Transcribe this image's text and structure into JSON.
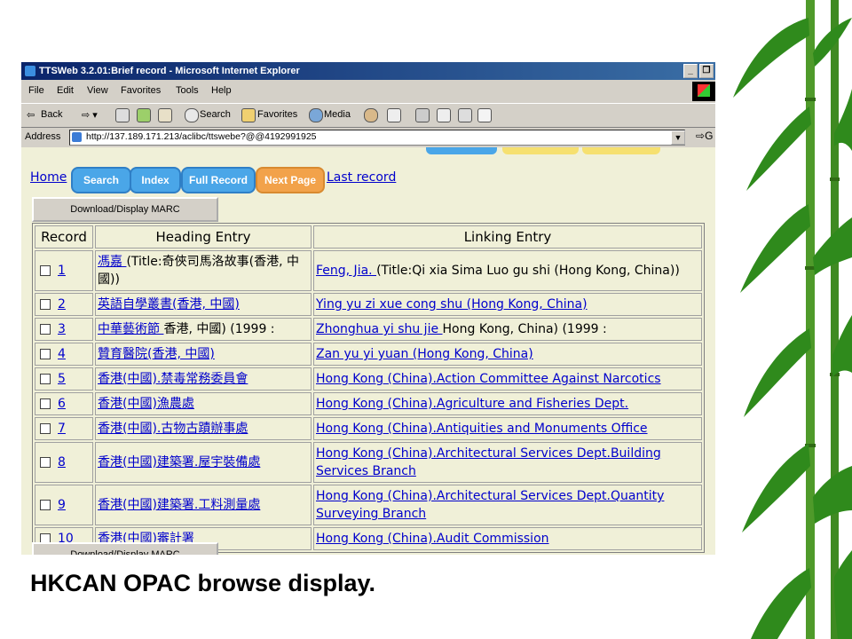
{
  "window": {
    "title": "TTSWeb 3.2.01:Brief record - Microsoft Internet Explorer",
    "minimize_glyph": "_",
    "restore_glyph": "❐"
  },
  "menu": [
    "File",
    "Edit",
    "View",
    "Favorites",
    "Tools",
    "Help"
  ],
  "toolbar": {
    "back": "Back",
    "search": "Search",
    "favorites": "Favorites",
    "media": "Media"
  },
  "address": {
    "label": "Address",
    "url": "http://137.189.171.213/aclibc/ttswebe?@@4192991925",
    "go": "G"
  },
  "page": {
    "links": {
      "home": "Home",
      "last_record": "Last record"
    },
    "buttons": {
      "search": "Search",
      "index": "Index",
      "full_record": "Full Record",
      "next_page": "Next Page"
    },
    "download_button": "Download/Display MARC",
    "table": {
      "headers": [
        "Record",
        "Heading Entry",
        "Linking Entry"
      ],
      "rows": [
        {
          "num": "1",
          "heading_link": "馮嘉 ",
          "heading_rest": "(Title:奇俠司馬洛故事(香港, 中國))",
          "linking_link": "Feng, Jia. ",
          "linking_rest": "(Title:Qi xia Sima Luo gu shi (Hong Kong, China))"
        },
        {
          "num": "2",
          "heading_link": "英語自學叢書(香港, 中國)",
          "heading_rest": "",
          "linking_link": "Ying yu zi xue cong shu (Hong Kong, China)",
          "linking_rest": ""
        },
        {
          "num": "3",
          "heading_link": "中華藝術節 ",
          "heading_rest": "香港, 中國) (1999 :",
          "linking_link": "Zhonghua yi shu jie ",
          "linking_rest": "Hong Kong, China) (1999 :"
        },
        {
          "num": "4",
          "heading_link": "贊育醫院(香港, 中國)",
          "heading_rest": "",
          "linking_link": "Zan yu yi yuan (Hong Kong, China)",
          "linking_rest": ""
        },
        {
          "num": "5",
          "heading_link": "香港(中國).禁毒常務委員會",
          "heading_rest": "",
          "linking_link": "Hong Kong (China).Action Committee Against Narcotics",
          "linking_rest": ""
        },
        {
          "num": "6",
          "heading_link": "香港(中國)漁農處",
          "heading_rest": "",
          "linking_link": "Hong Kong (China).Agriculture and Fisheries Dept.",
          "linking_rest": ""
        },
        {
          "num": "7",
          "heading_link": "香港(中國).古物古蹟辦事處",
          "heading_rest": "",
          "linking_link": "Hong Kong (China).Antiquities and Monuments Office",
          "linking_rest": ""
        },
        {
          "num": "8",
          "heading_link": "香港(中國)建築署.屋宇裝備處",
          "heading_rest": "",
          "linking_link": "Hong Kong (China).Architectural Services Dept.Building Services Branch",
          "linking_rest": ""
        },
        {
          "num": "9",
          "heading_link": "香港(中國)建築署.工料測量處",
          "heading_rest": "",
          "linking_link": "Hong Kong (China).Architectural Services Dept.Quantity Surveying Branch",
          "linking_rest": ""
        },
        {
          "num": "10",
          "heading_link": "香港(中國)審計署",
          "heading_rest": "",
          "linking_link": "Hong Kong (China).Audit Commission",
          "linking_rest": ""
        }
      ]
    }
  },
  "caption": "HKCAN OPAC browse display."
}
